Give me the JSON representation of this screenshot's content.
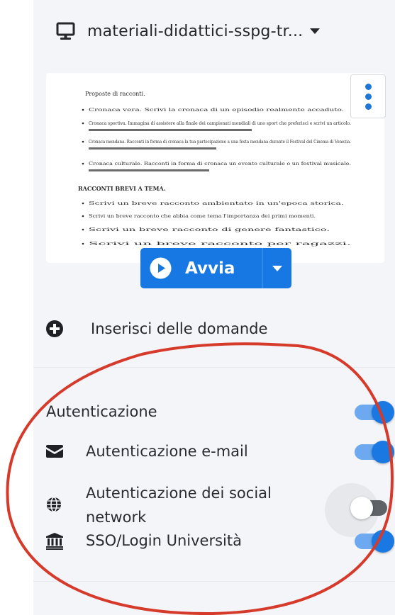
{
  "colors": {
    "panel_bg": "#f3f5f8",
    "accent_blue": "#1878e3",
    "toggle_track_on": "#6ca9f0",
    "annotation_red": "#d53a2a"
  },
  "header": {
    "icon": "monitor-icon",
    "title": "materiali-didattici-sspg-tr...",
    "caret": "caret-down-icon"
  },
  "preview": {
    "type": "document-thumbnail",
    "menu_icon": "kebab-menu-icon",
    "lines": [
      "Proposte di racconti.",
      "Cronaca vera. Scrivi la cronaca di un episodio realmente accaduto.",
      "Cronaca sportiva. Immagina di assistere alla finale dei campionati mondiali di uno sport che preferisci e scrivi un articolo.",
      "Cronaca mondana. Racconti in forma di cronaca la tua partecipazione a una festa mondana durante il Festival del Cinema di Venezia.",
      "Cronaca culturale. Racconti in forma di cronaca un evento culturale o un festival musicale.",
      "RACCONTI BREVI A TEMA.",
      "Scrivi un breve racconto ambientato in un'epoca storica.",
      "Scrivi un breve racconto che abbia come tema l'importanza dei primi momenti.",
      "Scrivi un breve racconto di genere fantastico.",
      "Scrivi un breve racconto per ragazzi."
    ]
  },
  "play_button": {
    "label": "Avvia",
    "icon": "play-circle-icon",
    "dropdown_icon": "caret-down-icon"
  },
  "add_questions": {
    "label": "Inserisci delle domande",
    "icon": "plus-circle-icon"
  },
  "settings": [
    {
      "label": "Autenticazione",
      "icon": null,
      "enabled": true
    },
    {
      "label": "Autenticazione e-mail",
      "icon": "envelope-icon",
      "enabled": true
    },
    {
      "label_line1": "Autenticazione dei social",
      "label_line2": "network",
      "icon": "globe-icon",
      "enabled": false
    },
    {
      "label": "SSO/Login Università",
      "icon": "university-icon",
      "enabled": true
    }
  ]
}
